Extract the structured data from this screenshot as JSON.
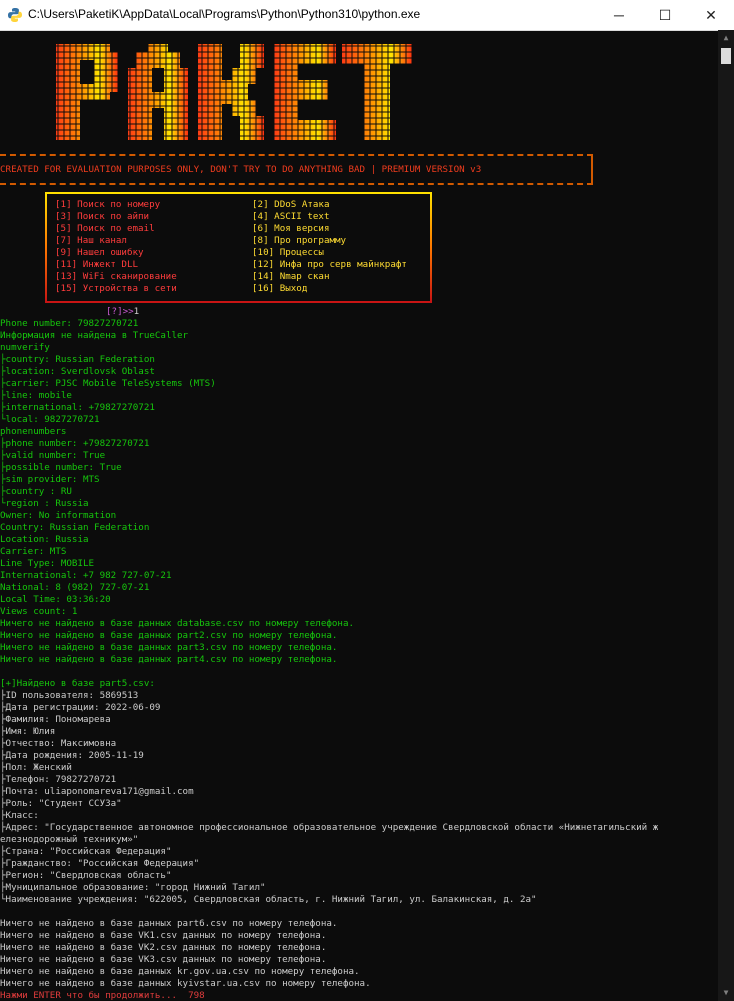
{
  "window": {
    "title": "C:\\Users\\PaketiK\\AppData\\Local\\Programs\\Python\\Python310\\python.exe",
    "minimize_label": "─",
    "maximize_label": "☐",
    "close_label": "✕",
    "app_icon": "python-icon"
  },
  "banner": {
    "logo_text": "PAKET",
    "text": "CREATED FOR EVALUATION PURPOSES ONLY, DON'T TRY TO DO ANYTHING BAD | PREMIUM VERSION v3",
    "colors": {
      "red": "#f03c1e",
      "orange": "#ff7800",
      "yellow": "#ffe100"
    }
  },
  "menu": {
    "left": [
      {
        "num": "[1]",
        "label": "Поиск по номеру"
      },
      {
        "num": "[3]",
        "label": "Поиск по айпи"
      },
      {
        "num": "[5]",
        "label": "Поиск по email"
      },
      {
        "num": "[7]",
        "label": "Наш канал"
      },
      {
        "num": "[9]",
        "label": "Нашел ошибку"
      },
      {
        "num": "[11]",
        "label": "Инжект DLL"
      },
      {
        "num": "[13]",
        "label": "WiFi сканирование"
      },
      {
        "num": "[15]",
        "label": "Устройства в сети"
      }
    ],
    "right": [
      {
        "num": "[2]",
        "label": "DDoS Атака"
      },
      {
        "num": "[4]",
        "label": "ASCII text"
      },
      {
        "num": "[6]",
        "label": "Моя версия"
      },
      {
        "num": "[8]",
        "label": "Про программу"
      },
      {
        "num": "[10]",
        "label": "Процессы"
      },
      {
        "num": "[12]",
        "label": "Инфа про серв майнкрафт"
      },
      {
        "num": "[14]",
        "label": "Nmap скан"
      },
      {
        "num": "[16]",
        "label": "Выход"
      }
    ]
  },
  "prompt": {
    "symbol": "[?]>>",
    "input": "1"
  },
  "output": {
    "lines1": [
      "Phone number: 79827270721",
      "Информация не найдена в TrueCaller",
      "numverify",
      "├country: Russian Federation",
      "├location: Sverdlovsk Oblast",
      "├carrier: PJSC Mobile TeleSystems (MTS)",
      "├line: mobile",
      "├international: +79827270721",
      "└local: 9827270721",
      "phonenumbers",
      "├phone number: +79827270721",
      "├valid number: True",
      "├possible number: True",
      "├sim provider: MTS",
      "├country : RU",
      "└region : Russia",
      "Owner: No information",
      "Country: Russian Federation",
      "Location: Russia",
      "Carrier: MTS",
      "Line Type: MOBILE",
      "International: +7 982 727-07-21",
      "National: 8 (982) 727-07-21",
      "Local Time: 03:36:20",
      "Views count: 1",
      "Ничего не найдено в базе данных database.csv по номеру телефона.",
      "Ничего не найдено в базе данных part2.csv по номеру телефона.",
      "Ничего не найдено в базе данных part3.csv по номеру телефона.",
      "Ничего не найдено в базе данных part4.csv по номеру телефона."
    ],
    "found_header": "[+]Найдено в базе part5.csv:",
    "lines2": [
      "├ID пользователя: 5869513",
      "├Дата регистрации: 2022-06-09",
      "├Фамилия: Пономарева",
      "├Имя: Юлия",
      "├Отчество: Максимовна",
      "├Дата рождения: 2005-11-19",
      "├Пол: Женский",
      "├Телефон: 79827270721",
      "├Почта: uliaponomareva171@gmail.com",
      "├Роль: \"Студент ССУЗа\"",
      "├Класс:",
      "├Адрес: \"Государственное автономное профессиональное образовательное учреждение Свердловской области «Нижнетагильский ж",
      "елезнодорожный техникум»\"",
      "├Страна: \"Российская Федерация\"",
      "├Гражданство: \"Российская Федерация\"",
      "├Регион: \"Свердловская область\"",
      "├Муниципальное образование: \"город Нижний Тагил\"",
      "└Наименование учреждения: \"622005, Свердловская область, г. Нижний Тагил, ул. Балакинская, д. 2а\""
    ],
    "lines3": [
      "Ничего не найдено в базе данных part6.csv по номеру телефона.",
      "Ничего не найдено в базе VK1.csv данных по номеру телефона.",
      "Ничего не найдено в базе VK2.csv данных по номеру телефона.",
      "Ничего не найдено в базе VK3.csv данных по номеру телефона.",
      "Ничего не найдено в базе данных kr.gov.ua.csv по номеру телефона.",
      "Ничего не найдено в базе данных kyivstar.ua.csv по номеру телефона."
    ],
    "enter_prompt": "Нажми ENTER что бы продолжить...  798"
  }
}
